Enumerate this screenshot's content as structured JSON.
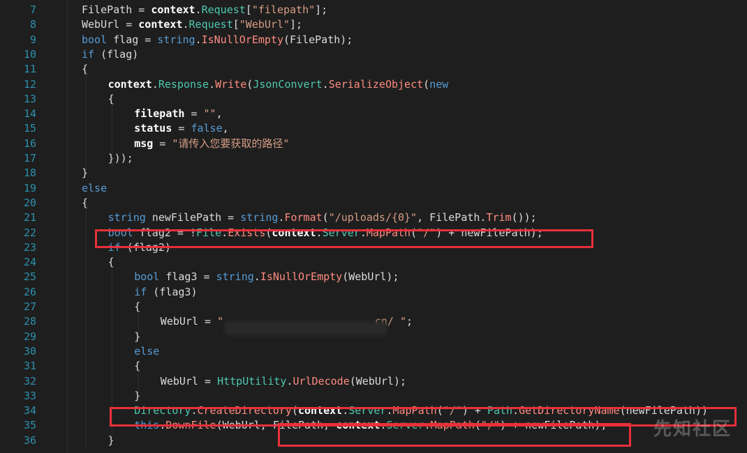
{
  "editor": {
    "lines": [
      {
        "n": "7",
        "tokens": [
          [
            "pl",
            "FilePath = "
          ],
          [
            "bo",
            "context"
          ],
          [
            "pl",
            "."
          ],
          [
            "ty",
            "Request"
          ],
          [
            "pl",
            "["
          ],
          [
            "st",
            "\"filepath\""
          ],
          [
            "pl",
            "];"
          ]
        ],
        "indent": 0
      },
      {
        "n": "8",
        "tokens": [
          [
            "pl",
            "WebUrl = "
          ],
          [
            "bo",
            "context"
          ],
          [
            "pl",
            "."
          ],
          [
            "ty",
            "Request"
          ],
          [
            "pl",
            "["
          ],
          [
            "st",
            "\"WebUrl\""
          ],
          [
            "pl",
            "];"
          ]
        ],
        "indent": 0
      },
      {
        "n": "9",
        "tokens": [
          [
            "kw",
            "bool"
          ],
          [
            "pl",
            " flag = "
          ],
          [
            "kw",
            "string"
          ],
          [
            "pl",
            "."
          ],
          [
            "me",
            "IsNullOrEmpty"
          ],
          [
            "pl",
            "(FilePath);"
          ]
        ],
        "indent": 0
      },
      {
        "n": "10",
        "tokens": [
          [
            "kw",
            "if"
          ],
          [
            "pl",
            " (flag)"
          ]
        ],
        "indent": 0
      },
      {
        "n": "11",
        "tokens": [
          [
            "pl",
            "{"
          ]
        ],
        "indent": 0
      },
      {
        "n": "12",
        "tokens": [
          [
            "bo",
            "context"
          ],
          [
            "pl",
            "."
          ],
          [
            "ty",
            "Response"
          ],
          [
            "pl",
            "."
          ],
          [
            "me",
            "Write"
          ],
          [
            "pl",
            "("
          ],
          [
            "ty",
            "JsonConvert"
          ],
          [
            "pl",
            "."
          ],
          [
            "me",
            "SerializeObject"
          ],
          [
            "pl",
            "("
          ],
          [
            "kw",
            "new"
          ]
        ],
        "indent": 1
      },
      {
        "n": "13",
        "tokens": [
          [
            "pl",
            "{"
          ]
        ],
        "indent": 1
      },
      {
        "n": "14",
        "tokens": [
          [
            "bo",
            "filepath"
          ],
          [
            "pl",
            " = "
          ],
          [
            "st",
            "\"\""
          ],
          [
            "pl",
            ","
          ]
        ],
        "indent": 2
      },
      {
        "n": "15",
        "tokens": [
          [
            "bo",
            "status"
          ],
          [
            "pl",
            " = "
          ],
          [
            "kw",
            "false"
          ],
          [
            "pl",
            ","
          ]
        ],
        "indent": 2
      },
      {
        "n": "16",
        "tokens": [
          [
            "bo",
            "msg"
          ],
          [
            "pl",
            " = "
          ],
          [
            "st",
            "\"请传入您要获取的路径\""
          ]
        ],
        "indent": 2
      },
      {
        "n": "17",
        "tokens": [
          [
            "pl",
            "}));"
          ]
        ],
        "indent": 1
      },
      {
        "n": "18",
        "tokens": [
          [
            "pl",
            "}"
          ]
        ],
        "indent": 0
      },
      {
        "n": "19",
        "tokens": [
          [
            "kw",
            "else"
          ]
        ],
        "indent": 0
      },
      {
        "n": "20",
        "tokens": [
          [
            "pl",
            "{"
          ]
        ],
        "indent": 0
      },
      {
        "n": "21",
        "tokens": [
          [
            "kw",
            "string"
          ],
          [
            "pl",
            " newFilePath = "
          ],
          [
            "kw",
            "string"
          ],
          [
            "pl",
            "."
          ],
          [
            "me",
            "Format"
          ],
          [
            "pl",
            "("
          ],
          [
            "st",
            "\"/uploads/{0}\""
          ],
          [
            "pl",
            ", FilePath."
          ],
          [
            "me",
            "Trim"
          ],
          [
            "pl",
            "());"
          ]
        ],
        "indent": 1
      },
      {
        "n": "22",
        "tokens": [
          [
            "kw",
            "bool"
          ],
          [
            "pl",
            " flag2 = !"
          ],
          [
            "ty",
            "File"
          ],
          [
            "pl",
            "."
          ],
          [
            "me",
            "Exists"
          ],
          [
            "pl",
            "("
          ],
          [
            "bo",
            "context"
          ],
          [
            "pl",
            "."
          ],
          [
            "ty",
            "Server"
          ],
          [
            "pl",
            "."
          ],
          [
            "me",
            "MapPath"
          ],
          [
            "pl",
            "("
          ],
          [
            "st",
            "\"/\""
          ],
          [
            "pl",
            ") + newFilePath);"
          ]
        ],
        "indent": 1
      },
      {
        "n": "23",
        "tokens": [
          [
            "kw",
            "if"
          ],
          [
            "pl",
            " (flag2)"
          ]
        ],
        "indent": 1
      },
      {
        "n": "24",
        "tokens": [
          [
            "pl",
            "{"
          ]
        ],
        "indent": 1
      },
      {
        "n": "25",
        "tokens": [
          [
            "kw",
            "bool"
          ],
          [
            "pl",
            " flag3 = "
          ],
          [
            "kw",
            "string"
          ],
          [
            "pl",
            "."
          ],
          [
            "me",
            "IsNullOrEmpty"
          ],
          [
            "pl",
            "(WebUrl);"
          ]
        ],
        "indent": 2
      },
      {
        "n": "26",
        "tokens": [
          [
            "kw",
            "if"
          ],
          [
            "pl",
            " (flag3)"
          ]
        ],
        "indent": 2
      },
      {
        "n": "27",
        "tokens": [
          [
            "pl",
            "{"
          ]
        ],
        "indent": 2
      },
      {
        "n": "28",
        "tokens": [
          [
            "pl",
            "WebUrl = "
          ],
          [
            "st",
            "\"                        cn/ \""
          ],
          [
            "pl",
            ";"
          ]
        ],
        "indent": 3
      },
      {
        "n": "29",
        "tokens": [
          [
            "pl",
            "}"
          ]
        ],
        "indent": 2
      },
      {
        "n": "30",
        "tokens": [
          [
            "kw",
            "else"
          ]
        ],
        "indent": 2
      },
      {
        "n": "31",
        "tokens": [
          [
            "pl",
            "{"
          ]
        ],
        "indent": 2
      },
      {
        "n": "32",
        "tokens": [
          [
            "pl",
            "WebUrl = "
          ],
          [
            "ty",
            "HttpUtility"
          ],
          [
            "pl",
            "."
          ],
          [
            "me",
            "UrlDecode"
          ],
          [
            "pl",
            "(WebUrl);"
          ]
        ],
        "indent": 3
      },
      {
        "n": "33",
        "tokens": [
          [
            "pl",
            "}"
          ]
        ],
        "indent": 2
      },
      {
        "n": "34",
        "tokens": [
          [
            "ty",
            "Directory"
          ],
          [
            "pl",
            "."
          ],
          [
            "me",
            "CreateDirectory"
          ],
          [
            "pl",
            "("
          ],
          [
            "bo",
            "context"
          ],
          [
            "pl",
            "."
          ],
          [
            "ty",
            "Server"
          ],
          [
            "pl",
            "."
          ],
          [
            "me",
            "MapPath"
          ],
          [
            "pl",
            "("
          ],
          [
            "st",
            "\"/\""
          ],
          [
            "pl",
            ") + "
          ],
          [
            "ty",
            "Path"
          ],
          [
            "pl",
            "."
          ],
          [
            "me",
            "GetDirectoryName"
          ],
          [
            "pl",
            "(newFilePath))"
          ]
        ],
        "indent": 2
      },
      {
        "n": "35",
        "tokens": [
          [
            "kw",
            "this"
          ],
          [
            "pl",
            "."
          ],
          [
            "me",
            "DownFile"
          ],
          [
            "pl",
            "(WebUrl, FilePath, "
          ],
          [
            "bo",
            "context"
          ],
          [
            "pl",
            "."
          ],
          [
            "ty",
            "Server"
          ],
          [
            "pl",
            "."
          ],
          [
            "me",
            "MapPath"
          ],
          [
            "pl",
            "("
          ],
          [
            "st",
            "\"/\""
          ],
          [
            "pl",
            ") + newFilePath);"
          ]
        ],
        "indent": 2
      },
      {
        "n": "36",
        "tokens": [
          [
            "pl",
            "}"
          ]
        ],
        "indent": 1
      }
    ]
  },
  "watermark": "先知社区",
  "colors": {
    "background": "#1e1e1e",
    "line_number": "#2b91af",
    "keyword": "#569cd6",
    "type": "#4ec9b0",
    "method": "#ff8c80",
    "string": "#d69d85",
    "highlight_box": "#e8303a"
  }
}
